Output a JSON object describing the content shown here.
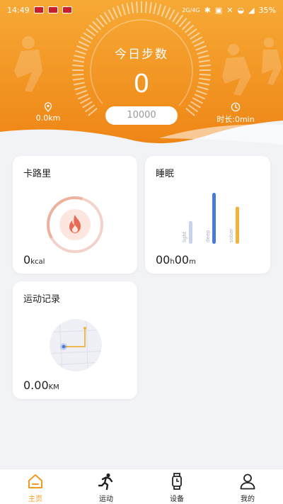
{
  "status_bar": {
    "time": "14:49",
    "network": "2G/4G",
    "battery": "35%"
  },
  "header": {
    "title": "今日步数",
    "steps": "0",
    "goal": "10000",
    "distance": "0.0km",
    "duration": "时长:0min"
  },
  "cards": {
    "calorie": {
      "title": "卡路里",
      "value": "0",
      "unit": "kcal"
    },
    "sleep": {
      "title": "睡眠",
      "hours": "00",
      "hours_unit": "h",
      "minutes": "00",
      "minutes_unit": "m",
      "bars": [
        {
          "label": "light",
          "color": "#c9d3ee",
          "level": 0.45
        },
        {
          "label": "deep",
          "color": "#4a7ad8",
          "level": 1.0
        },
        {
          "label": "sober",
          "color": "#f2b23c",
          "level": 0.73
        }
      ]
    },
    "record": {
      "title": "运动记录",
      "value": "0.00",
      "unit": "KM"
    }
  },
  "nav": [
    {
      "label": "主页",
      "icon": "home-icon",
      "active": true
    },
    {
      "label": "运动",
      "icon": "running-person-icon",
      "active": false
    },
    {
      "label": "设备",
      "icon": "watch-icon",
      "active": false
    },
    {
      "label": "我的",
      "icon": "user-icon",
      "active": false
    }
  ],
  "colors": {
    "accent": "#f39a1e",
    "header_top": "#f6a531",
    "header_bottom": "#ef8a17",
    "flame": "#e86a52"
  }
}
